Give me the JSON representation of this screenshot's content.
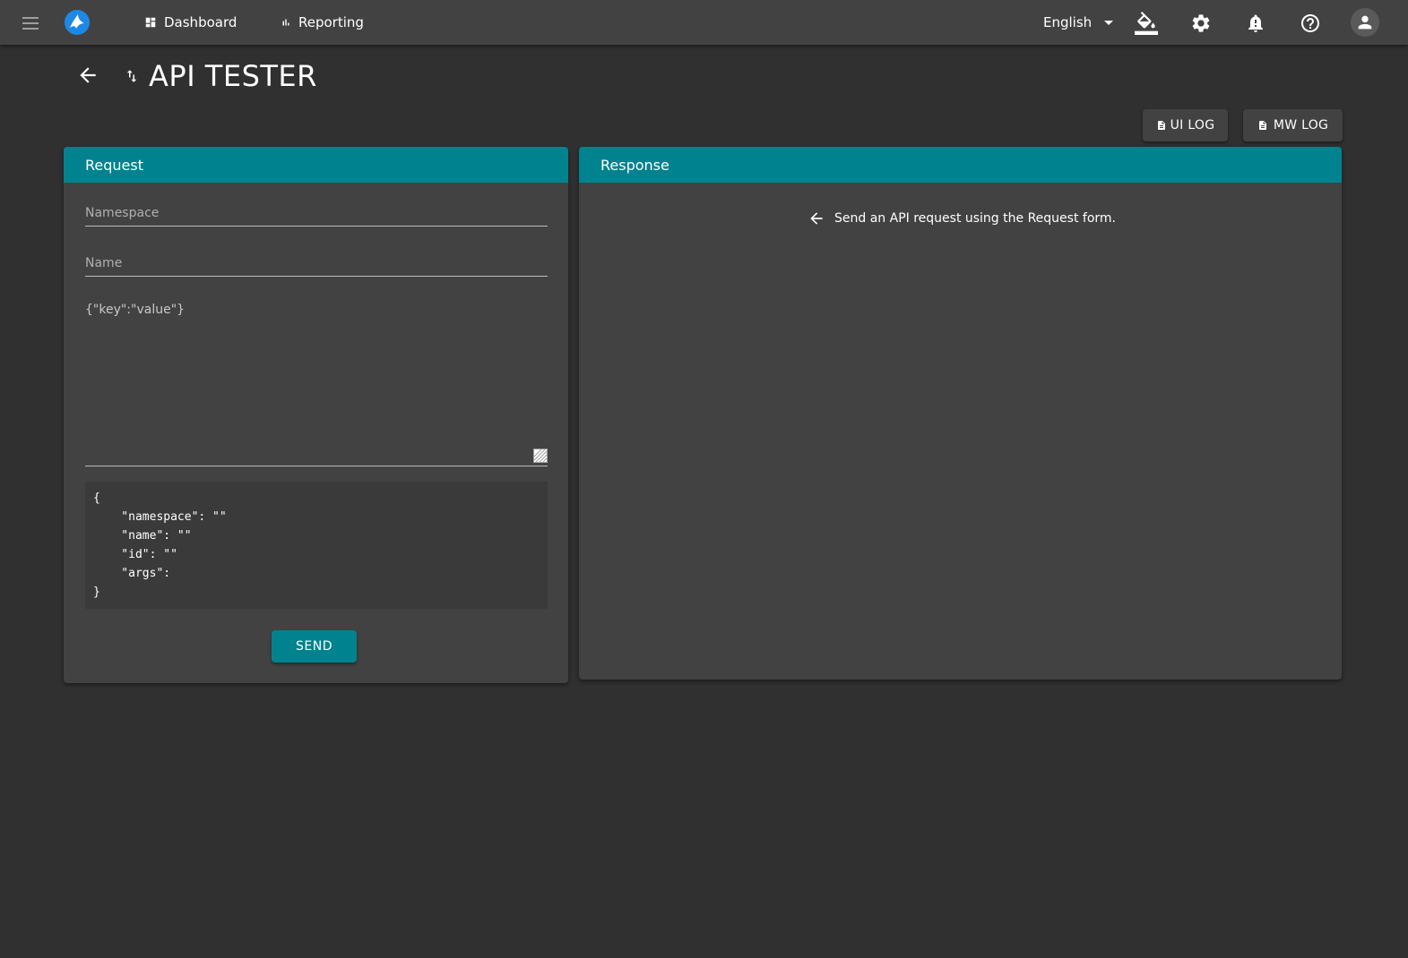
{
  "topbar": {
    "nav": [
      {
        "label": "Dashboard",
        "icon": "dashboard-icon"
      },
      {
        "label": "Reporting",
        "icon": "bar-chart-icon"
      }
    ],
    "language": "English",
    "icons": [
      "paint-bucket-icon",
      "gear-icon",
      "bell-alert-icon",
      "help-circle-icon",
      "account-icon"
    ]
  },
  "page": {
    "title": "API TESTER",
    "title_icon": "swap-vertical-icon"
  },
  "actions": {
    "ui_log_label": "UI LOG",
    "mw_log_label": "MW LOG"
  },
  "request": {
    "header": "Request",
    "namespace_placeholder": "Namespace",
    "name_placeholder": "Name",
    "args_placeholder": "{\"key\":\"value\"}",
    "preview": "{\n    \"namespace\": \"\"\n    \"name\": \"\"\n    \"id\": \"\"\n    \"args\":\n}",
    "send_label": "SEND"
  },
  "response": {
    "header": "Response",
    "message": "Send an API request using the Request form."
  },
  "colors": {
    "accent": "#00838f",
    "background": "#303030",
    "surface": "#424242"
  }
}
